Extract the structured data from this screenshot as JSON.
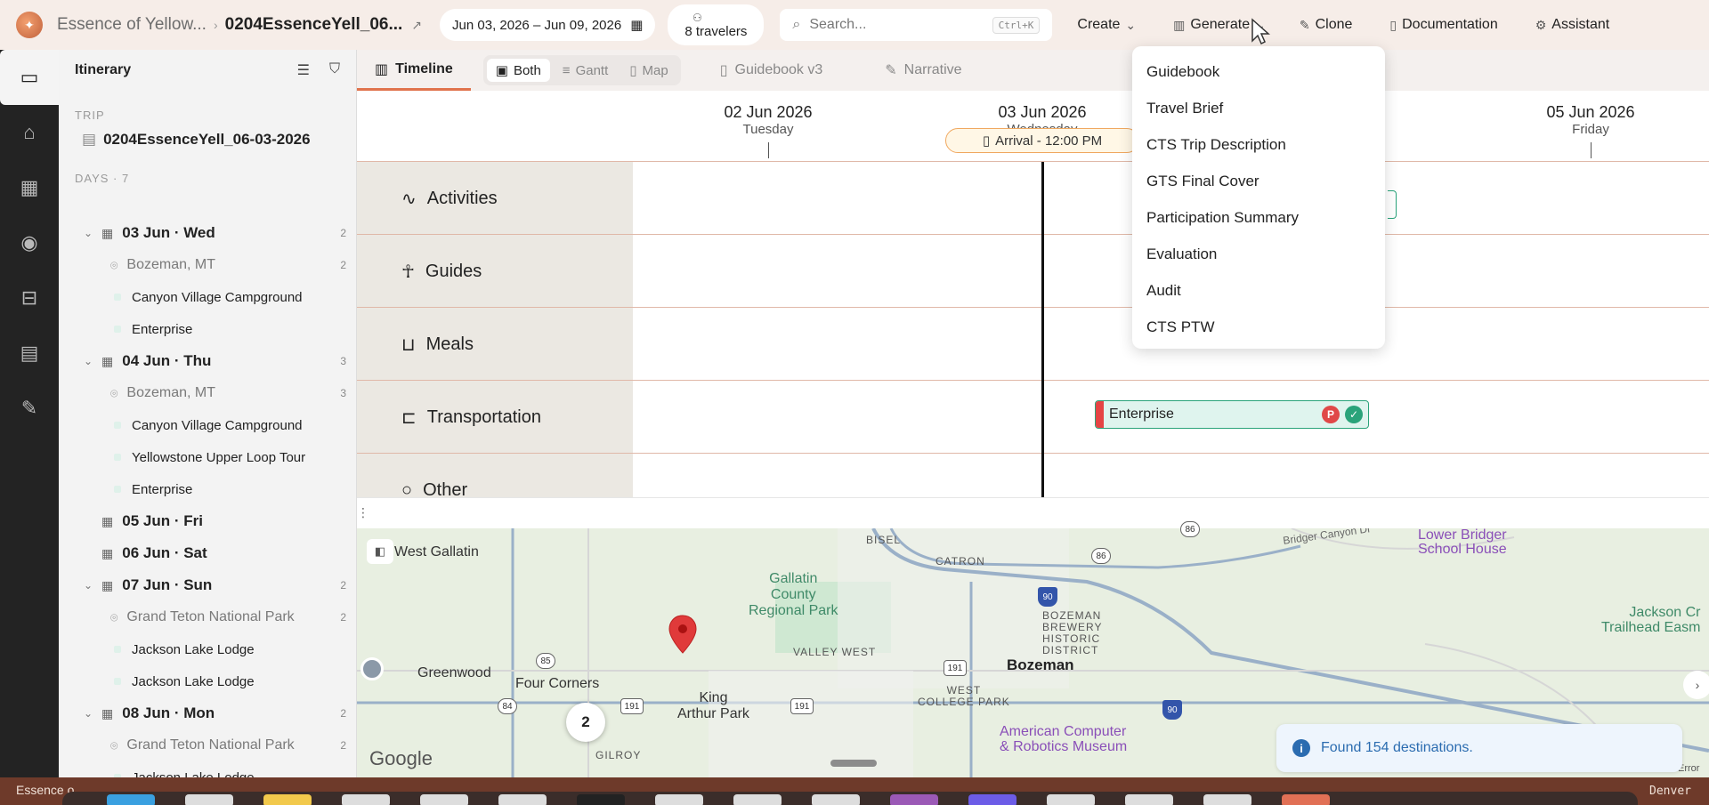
{
  "header": {
    "crumb_project": "Essence of Yellow...",
    "crumb_trip": "0204EssenceYell_06...",
    "date_range": "Jun 03, 2026 – Jun 09, 2026",
    "travelers": "8 travelers",
    "search_placeholder": "Search...",
    "search_shortcut": "Ctrl+K",
    "menu": {
      "create": "Create",
      "generate": "Generate",
      "clone": "Clone",
      "documentation": "Documentation",
      "assistant": "Assistant"
    }
  },
  "sidebar": {
    "title": "Itinerary",
    "trip_section": "TRIP",
    "trip_name": "0204EssenceYell_06-03-2026",
    "days_section": "DAYS · 7",
    "rows": [
      {
        "kind": "day",
        "label": "03 Jun · Wed",
        "count": "2",
        "chevron": true
      },
      {
        "kind": "loc",
        "label": "Bozeman, MT",
        "count": "2"
      },
      {
        "kind": "item",
        "label": "Canyon Village Campground"
      },
      {
        "kind": "item",
        "label": "Enterprise"
      },
      {
        "kind": "day",
        "label": "04 Jun · Thu",
        "count": "3",
        "chevron": true
      },
      {
        "kind": "loc",
        "label": "Bozeman, MT",
        "count": "3"
      },
      {
        "kind": "item",
        "label": "Canyon Village Campground"
      },
      {
        "kind": "item",
        "label": "Yellowstone Upper Loop Tour"
      },
      {
        "kind": "item",
        "label": "Enterprise"
      },
      {
        "kind": "day",
        "label": "05 Jun · Fri",
        "count": "",
        "chevron": false
      },
      {
        "kind": "day",
        "label": "06 Jun · Sat",
        "count": "",
        "chevron": false
      },
      {
        "kind": "day",
        "label": "07 Jun · Sun",
        "count": "2",
        "chevron": true
      },
      {
        "kind": "loc",
        "label": "Grand Teton National Park",
        "count": "2"
      },
      {
        "kind": "item",
        "label": "Jackson Lake Lodge"
      },
      {
        "kind": "item",
        "label": "Jackson Lake Lodge"
      },
      {
        "kind": "day",
        "label": "08 Jun · Mon",
        "count": "2",
        "chevron": true
      },
      {
        "kind": "loc",
        "label": "Grand Teton National Park",
        "count": "2"
      },
      {
        "kind": "item",
        "label": "Jackson Lake Lodge"
      }
    ]
  },
  "tabs": {
    "timeline": "Timeline",
    "view_both": "Both",
    "view_gantt": "Gantt",
    "view_map": "Map",
    "guidebook": "Guidebook v3",
    "narrative": "Narrative"
  },
  "timeline": {
    "dates": [
      {
        "date": "02 Jun 2026",
        "weekday": "Tuesday"
      },
      {
        "date": "03 Jun 2026",
        "weekday": "Wednesday"
      },
      {
        "date": "05 Jun 2026",
        "weekday": "Friday"
      }
    ],
    "arrival": "Arrival - 12:00 PM",
    "lanes": [
      "Activities",
      "Guides",
      "Meals",
      "Transportation",
      "Other"
    ],
    "events": [
      {
        "lane": "Transportation",
        "label": "Enterprise",
        "badge_p": "P",
        "badge_ok": "✓"
      }
    ]
  },
  "generate_menu": {
    "items": [
      "Guidebook",
      "Travel Brief",
      "CTS Trip Description",
      "GTS Final Cover",
      "Participation Summary",
      "Evaluation",
      "Audit",
      "CTS PTW"
    ]
  },
  "map": {
    "labels": {
      "west_gallatin": "West Gallatin",
      "bisel": "BISEL",
      "catron": "CATRON",
      "gallatin_park": "Gallatin\nCounty\nRegional Park",
      "bozeman_brewery": "BOZEMAN\nBREWERY\nHISTORIC\nDISTRICT",
      "valley_west": "VALLEY WEST",
      "greenwood": "Greenwood",
      "four_corners": "Four Corners",
      "king_arthur": "King\nArthur Park",
      "west_college_park": "WEST\nCOLLEGE PARK",
      "bozeman": "Bozeman",
      "gilroy": "GILROY",
      "museum": "American Computer\n& Robotics Museum",
      "lower_bridger": "Lower Bridger\nSchool House",
      "bridger_canyon": "Bridger Canyon Dr",
      "jackson_creek": "Jackson Cr\nTrailhead Easm",
      "error": "Error"
    },
    "route_shields": [
      "90",
      "86",
      "191",
      "85",
      "84",
      "191",
      "191",
      "90",
      "86"
    ],
    "cluster_count": "2",
    "attribution": "Google",
    "toast": "Found 154 destinations."
  },
  "status": {
    "left": "Essence o",
    "right": "Denver"
  },
  "colors": {
    "accent": "#e0734c",
    "event_fill": "#dff4ee",
    "event_border": "#2aa37a",
    "badge_p": "#e04848",
    "badge_ok": "#2aa37a"
  }
}
